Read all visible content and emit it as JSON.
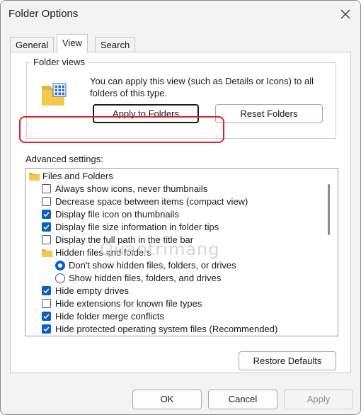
{
  "window": {
    "title": "Folder Options"
  },
  "tabs": [
    {
      "label": "General",
      "active": false
    },
    {
      "label": "View",
      "active": true
    },
    {
      "label": "Search",
      "active": false
    }
  ],
  "folder_views": {
    "legend": "Folder views",
    "description": "You can apply this view (such as Details or Icons) to all folders of this type.",
    "apply_button": "Apply to Folders",
    "reset_button": "Reset Folders"
  },
  "advanced": {
    "label": "Advanced settings:",
    "items": [
      {
        "type": "folder",
        "label": "Files and Folders",
        "indent": 0
      },
      {
        "type": "checkbox",
        "label": "Always show icons, never thumbnails",
        "checked": false,
        "indent": 1
      },
      {
        "type": "checkbox",
        "label": "Decrease space between items (compact view)",
        "checked": false,
        "indent": 1
      },
      {
        "type": "checkbox",
        "label": "Display file icon on thumbnails",
        "checked": true,
        "indent": 1
      },
      {
        "type": "checkbox",
        "label": "Display file size information in folder tips",
        "checked": true,
        "indent": 1
      },
      {
        "type": "checkbox",
        "label": "Display the full path in the title bar",
        "checked": false,
        "indent": 1
      },
      {
        "type": "folder",
        "label": "Hidden files and folders",
        "indent": 1
      },
      {
        "type": "radio",
        "label": "Don't show hidden files, folders, or drives",
        "checked": true,
        "indent": 2
      },
      {
        "type": "radio",
        "label": "Show hidden files, folders, and drives",
        "checked": false,
        "indent": 2
      },
      {
        "type": "checkbox",
        "label": "Hide empty drives",
        "checked": true,
        "indent": 1
      },
      {
        "type": "checkbox",
        "label": "Hide extensions for known file types",
        "checked": false,
        "indent": 1
      },
      {
        "type": "checkbox",
        "label": "Hide folder merge conflicts",
        "checked": true,
        "indent": 1
      },
      {
        "type": "checkbox",
        "label": "Hide protected operating system files (Recommended)",
        "checked": true,
        "indent": 1
      }
    ]
  },
  "restore_button": "Restore Defaults",
  "footer": {
    "ok": "OK",
    "cancel": "Cancel",
    "apply": "Apply"
  },
  "watermark": "Quantrimang",
  "colors": {
    "accent": "#0a5ec5",
    "highlight": "#e0202a",
    "folder": "#f2c94c"
  }
}
